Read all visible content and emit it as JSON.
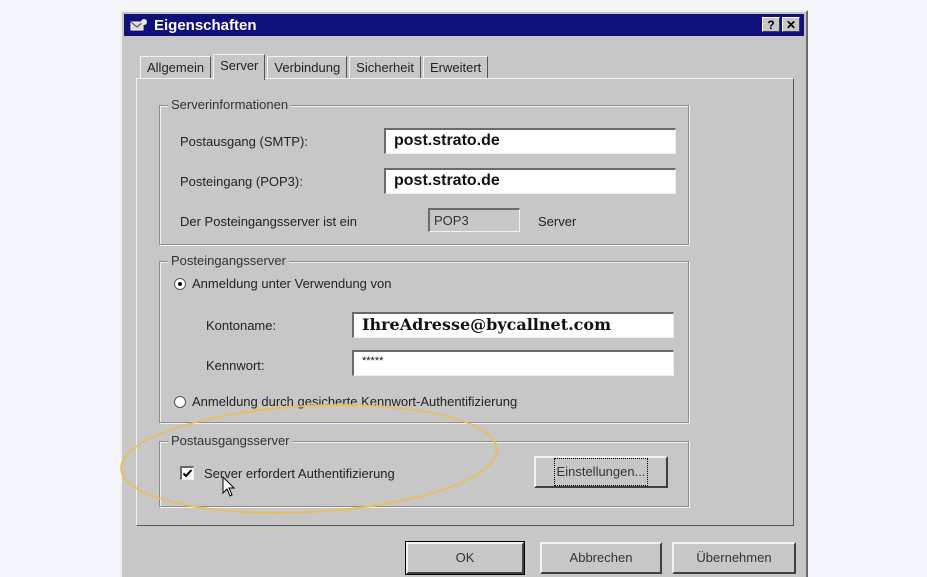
{
  "window": {
    "title": "Eigenschaften",
    "help_btn": "?",
    "close_btn": "✕"
  },
  "tabs": [
    {
      "label": "Allgemein",
      "active": false
    },
    {
      "label": "Server",
      "active": true
    },
    {
      "label": "Verbindung",
      "active": false
    },
    {
      "label": "Sicherheit",
      "active": false
    },
    {
      "label": "Erweitert",
      "active": false
    }
  ],
  "serverinfo": {
    "legend": "Serverinformationen",
    "smtp_label": "Postausgang (SMTP):",
    "smtp_value": "post.strato.de",
    "pop3_label": "Posteingang (POP3):",
    "pop3_value": "post.strato.de",
    "type_label_pre": "Der Posteingangsserver ist ein",
    "type_value": "POP3",
    "type_label_post": "Server"
  },
  "incoming": {
    "legend": "Posteingangsserver",
    "radio_login_label": "Anmeldung unter Verwendung von",
    "account_label": "Kontoname:",
    "account_value": "IhreAdresse@bycallnet.com",
    "password_label": "Kennwort:",
    "password_value": "*****",
    "radio_spa_label": "Anmeldung durch gesicherte Kennwort-Authentifizierung"
  },
  "outgoing": {
    "legend": "Postausgangsserver",
    "auth_checkbox_label": "Server erfordert Authentifizierung",
    "auth_checked": true,
    "settings_button": "Einstellungen..."
  },
  "footer": {
    "ok": "OK",
    "cancel": "Abbrechen",
    "apply": "Übernehmen"
  },
  "colors": {
    "titlebar": "#10107a",
    "dialog_bg": "#c7c7c7",
    "highlight_ellipse": "#e7c05b"
  }
}
